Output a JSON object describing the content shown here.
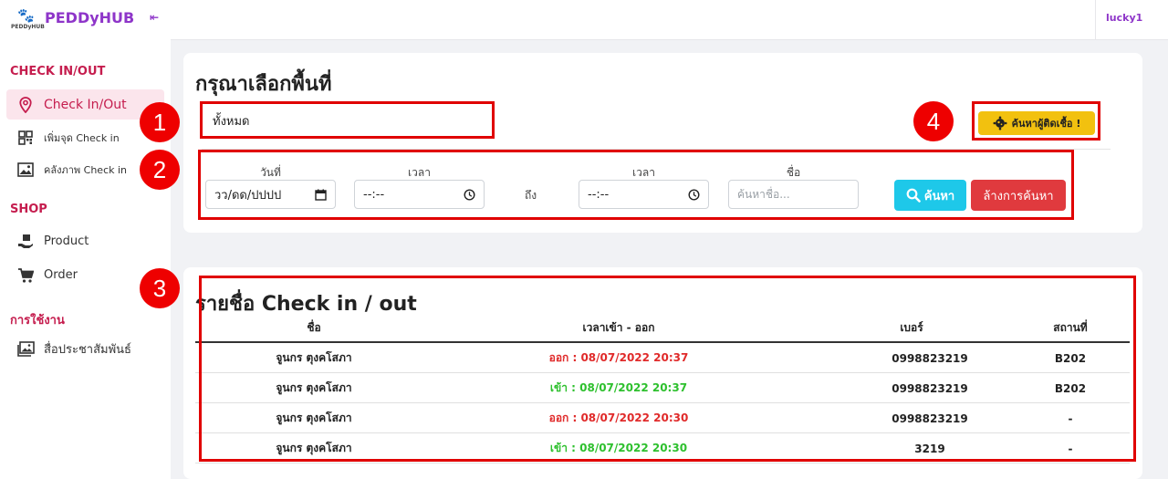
{
  "brand": {
    "name": "PEDDyHUB",
    "logo_text": "PEDDyHUB",
    "collapse": "⇤"
  },
  "user": {
    "name": "lucky1"
  },
  "sidebar": {
    "sections": [
      {
        "title": "CHECK IN/OUT"
      },
      {
        "title": "SHOP"
      },
      {
        "title": "การใช้งาน"
      }
    ],
    "items": [
      {
        "label": "Check In/Out",
        "icon": "location-pin-icon",
        "active": true
      },
      {
        "label": "เพิ่มจุด Check in",
        "icon": "qr-code-icon"
      },
      {
        "label": "คลังภาพ Check in",
        "icon": "image-icon"
      },
      {
        "label": "Product",
        "icon": "hand-box-icon"
      },
      {
        "label": "Order",
        "icon": "cart-icon"
      },
      {
        "label": "สื่อประชาสัมพันธ์",
        "icon": "images-icon"
      }
    ]
  },
  "filter": {
    "title": "กรุณาเลือกพื้นที่",
    "area_value": "ทั้งหมด",
    "infect_button": "ค้นหาผู้ติดเชื้อ !",
    "date_label": "วันที่",
    "date_placeholder": "วว/ดด/ปปปป",
    "time_label_1": "เวลา",
    "time_label_2": "เวลา",
    "time_placeholder": "--:--",
    "to_label": "ถึง",
    "name_label": "ชื่อ",
    "name_placeholder": "ค้นหาชื่อ...",
    "search_button": "ค้นหา",
    "clear_button": "ล้างการค้นหา"
  },
  "table": {
    "title": "รายชื่อ Check in / out",
    "headers": [
      "ชื่อ",
      "เวลาเข้า - ออก",
      "เบอร์",
      "สถานที่"
    ],
    "rows": [
      {
        "name": "จูนกร ตุงคโสภา",
        "time": "ออก : 08/07/2022 20:37",
        "status": "out",
        "phone": "0998823219",
        "place": "B202"
      },
      {
        "name": "จูนกร ตุงคโสภา",
        "time": "เข้า : 08/07/2022 20:37",
        "status": "in",
        "phone": "0998823219",
        "place": "B202"
      },
      {
        "name": "จูนกร ตุงคโสภา",
        "time": "ออก : 08/07/2022 20:30",
        "status": "out",
        "phone": "0998823219",
        "place": "-"
      },
      {
        "name": "จูนกร ตุงคโสภา",
        "time": "เข้า : 08/07/2022 20:30",
        "status": "in",
        "phone": "3219",
        "place": "-"
      }
    ]
  },
  "annotations": [
    "1",
    "2",
    "3",
    "4"
  ],
  "colors": {
    "accent": "#c51d4e",
    "brand": "#8e35c9",
    "annotation": "#e00000",
    "search": "#1ec8e9",
    "clear": "#e03a3e",
    "infect": "#f2c10f",
    "out": "#e02a2a",
    "in": "#2ec02e"
  }
}
